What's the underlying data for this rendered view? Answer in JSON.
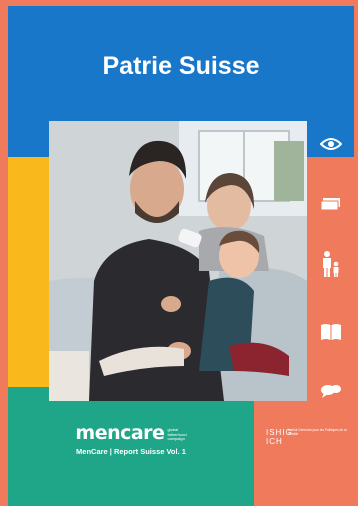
{
  "cover": {
    "title": "Patrie Suisse",
    "colors": {
      "background": "#f07a5c",
      "header": "#1877c9",
      "yellow": "#f9b91c",
      "green": "#1fa688"
    }
  },
  "icons": [
    {
      "name": "eye-icon"
    },
    {
      "name": "money-icon"
    },
    {
      "name": "parent-child-icon"
    },
    {
      "name": "book-icon"
    },
    {
      "name": "speech-bubbles-icon"
    }
  ],
  "mencare": {
    "wordmark": "mencare",
    "tagline": [
      "global",
      "fatherhood",
      "campaign"
    ],
    "subtitle": "MenCare | Report Suisse Vol. 1"
  },
  "partner": {
    "mark_top": "ISHIG",
    "mark_bottom": "ICH",
    "description": "Institut Genevois pour les Politiques de la Famille"
  }
}
